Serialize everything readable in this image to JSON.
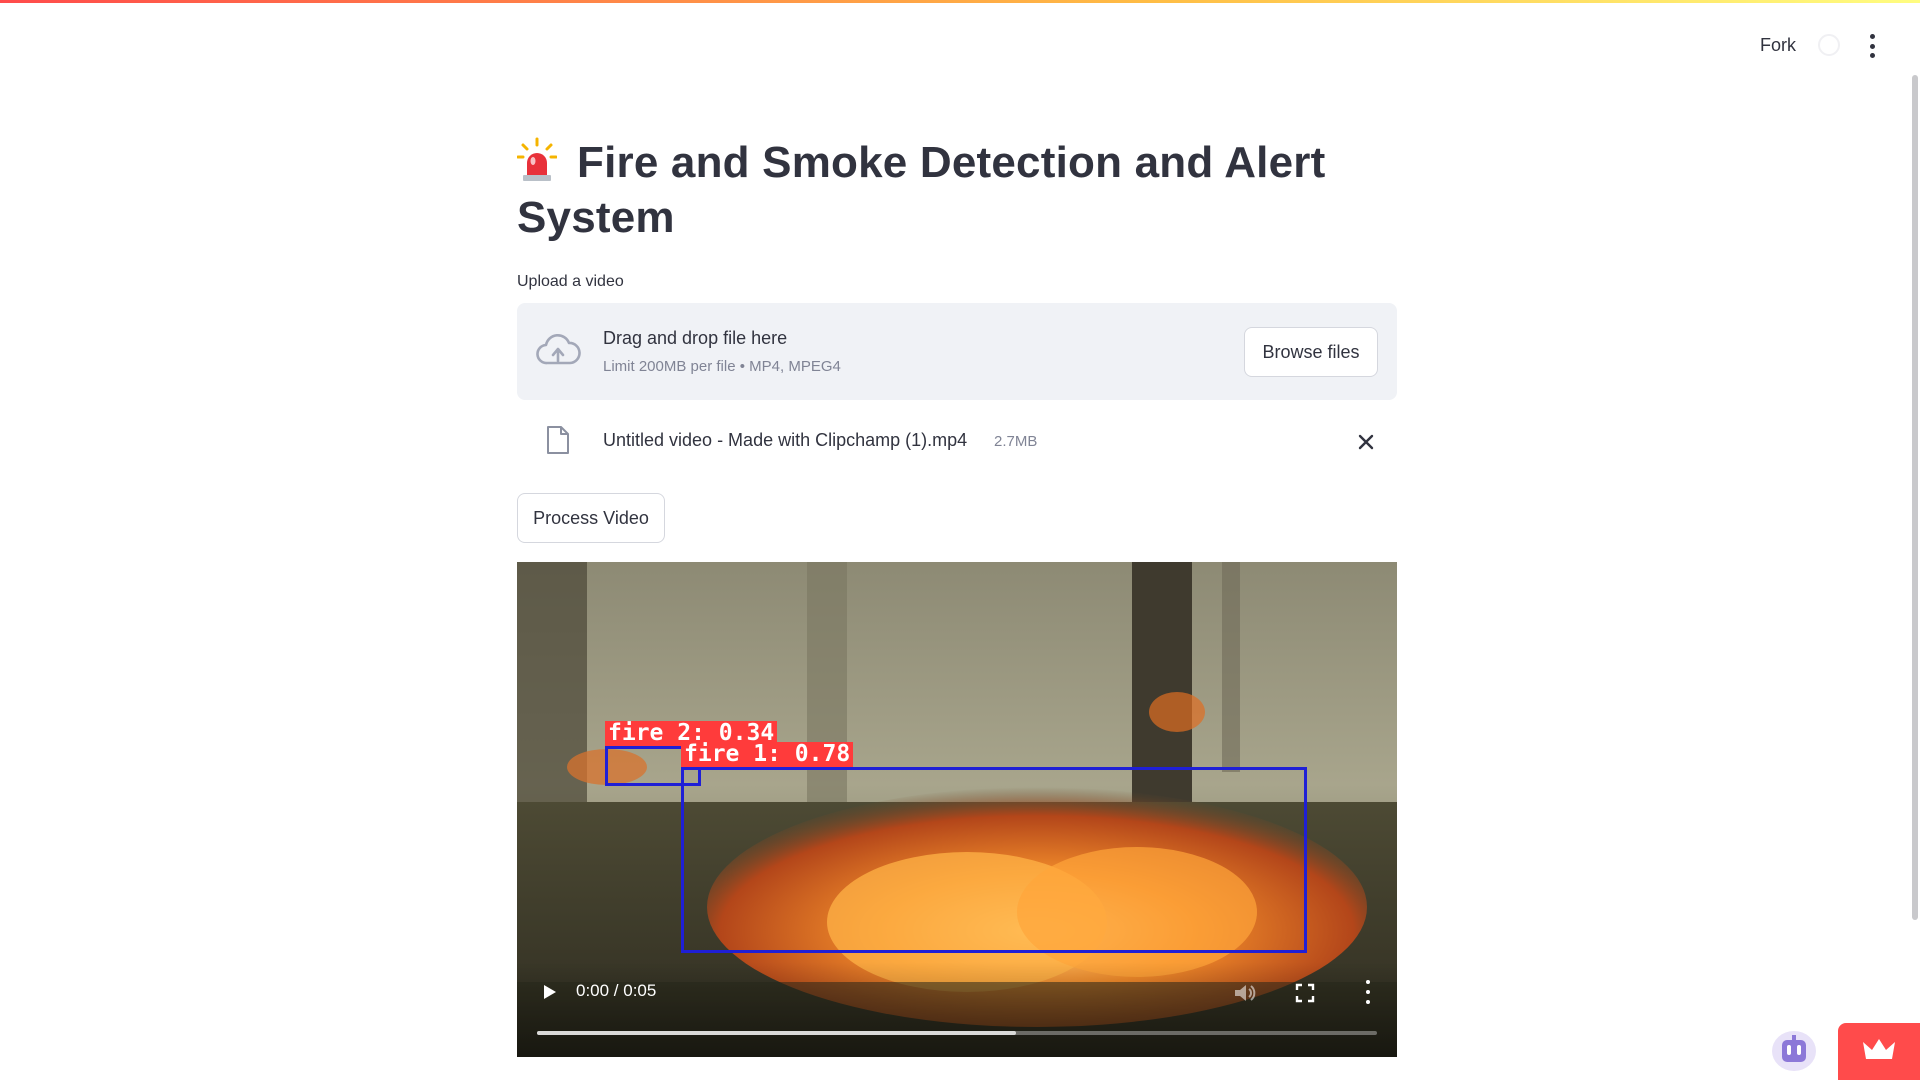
{
  "header": {
    "fork_label": "Fork",
    "icons": [
      "github-icon",
      "main-menu-icon"
    ]
  },
  "main": {
    "title": "Fire and Smoke Detection and Alert System",
    "title_icon": "police-light-icon",
    "uploader": {
      "label": "Upload a video",
      "drop_text": "Drag and drop file here",
      "limit_text": "Limit 200MB per file • MP4, MPEG4",
      "browse_label": "Browse files"
    },
    "uploaded_file": {
      "name": "Untitled video - Made with Clipchamp (1).mp4",
      "size": "2.7MB"
    },
    "process_button": "Process Video",
    "video": {
      "detections": [
        {
          "label": "fire 2: 0.34"
        },
        {
          "label": "fire 1: 0.78"
        }
      ],
      "time": "0:00 / 0:05",
      "buffered_fraction": 0.57,
      "played_fraction": 0.0
    }
  },
  "colors": {
    "accent": "#ff4b4b",
    "text": "#31333f",
    "muted": "#808495",
    "dropzone_bg": "#f0f2f6",
    "detection_box": "#1f1fd6",
    "detection_label_bg": "#ff3b3b"
  }
}
